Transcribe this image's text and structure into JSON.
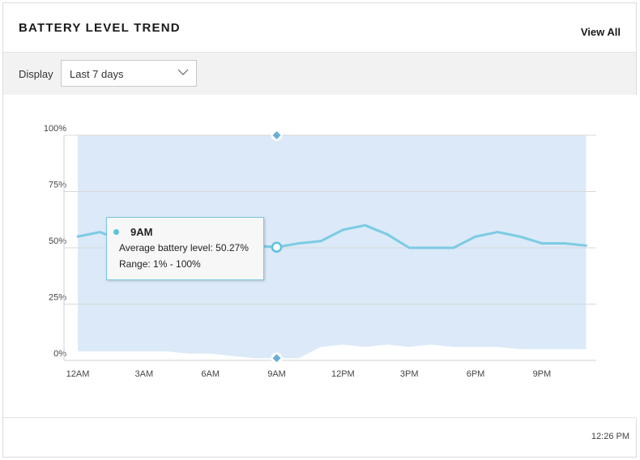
{
  "card": {
    "title": "BATTERY LEVEL TREND",
    "view_all_label": "View All"
  },
  "filter": {
    "label": "Display",
    "selected": "Last 7 days"
  },
  "tooltip": {
    "title": "9AM",
    "line1": "Average battery level: 50.27%",
    "line2": "Range: 1% - 100%"
  },
  "footer": {
    "time": "12:26 PM"
  },
  "colors": {
    "line": "#7ccbe3",
    "range_fill": "#dbe9f8",
    "marker": "#5ec1de",
    "grid": "#d9d9d9"
  },
  "chart_data": {
    "type": "line",
    "title": "",
    "xlabel": "",
    "ylabel": "",
    "ylim": [
      0,
      100
    ],
    "y_ticks": [
      "0%",
      "25%",
      "50%",
      "75%",
      "100%"
    ],
    "x_ticks": [
      "12AM",
      "3AM",
      "6AM",
      "9AM",
      "12PM",
      "3PM",
      "6PM",
      "9PM"
    ],
    "x_tick_hours": [
      0,
      3,
      6,
      9,
      12,
      15,
      18,
      21
    ],
    "x_hours": [
      0,
      1,
      2,
      3,
      4,
      5,
      6,
      7,
      8,
      9,
      10,
      11,
      12,
      13,
      14,
      15,
      16,
      17,
      18,
      19,
      20,
      21,
      22,
      23
    ],
    "series": [
      {
        "values": [
          55,
          57,
          53,
          52,
          52,
          52,
          52,
          54,
          51,
          50.27,
          52,
          53,
          58,
          60,
          56,
          50,
          50,
          50,
          55,
          57,
          55,
          52,
          52,
          51
        ]
      }
    ],
    "range": {
      "upper": [
        100,
        100,
        100,
        100,
        100,
        100,
        100,
        100,
        100,
        100,
        100,
        100,
        100,
        100,
        100,
        100,
        100,
        100,
        100,
        100,
        100,
        100,
        100,
        100
      ],
      "lower": [
        4,
        4,
        4,
        4,
        4,
        3,
        3,
        2,
        1,
        1,
        1,
        6,
        7,
        6,
        7,
        6,
        7,
        6,
        6,
        6,
        5,
        5,
        5,
        5
      ]
    },
    "highlight": {
      "hour": 9,
      "value": 50.27,
      "range": [
        1,
        100
      ]
    },
    "grid": true,
    "legend": "none"
  }
}
